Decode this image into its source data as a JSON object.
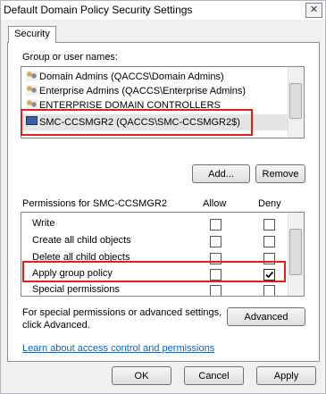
{
  "window": {
    "title": "Default Domain Policy Security Settings",
    "close_glyph": "✕"
  },
  "tabs": [
    {
      "label": "Security"
    }
  ],
  "groups": {
    "heading": "Group or user names:",
    "items": [
      {
        "label": "Domain Admins (QACCS\\Domain Admins)",
        "icon": "group-icon"
      },
      {
        "label": "Enterprise Admins (QACCS\\Enterprise Admins)",
        "icon": "group-icon"
      },
      {
        "label": "ENTERPRISE DOMAIN CONTROLLERS",
        "icon": "group-icon"
      },
      {
        "label": "SMC-CCSMGR2 (QACCS\\SMC-CCSMGR2$)",
        "icon": "computer-icon",
        "selected": true
      }
    ],
    "add_label": "Add...",
    "remove_label": "Remove"
  },
  "permissions": {
    "heading": "Permissions for SMC-CCSMGR2",
    "allow_header": "Allow",
    "deny_header": "Deny",
    "rows": [
      {
        "label": "Write",
        "allow": false,
        "deny": false
      },
      {
        "label": "Create all child objects",
        "allow": false,
        "deny": false
      },
      {
        "label": "Delete all child objects",
        "allow": false,
        "deny": false
      },
      {
        "label": "Apply group policy",
        "allow": false,
        "deny": true
      },
      {
        "label": "Special permissions",
        "allow": false,
        "deny": false
      }
    ]
  },
  "advanced": {
    "text_line1": "For special permissions or advanced settings,",
    "text_line2": "click Advanced.",
    "button_label": "Advanced"
  },
  "learn_link": "Learn about access control and permissions",
  "footer": {
    "ok_label": "OK",
    "cancel_label": "Cancel",
    "apply_label": "Apply"
  },
  "colors": {
    "highlight_box": "#e1201d",
    "link": "#0066cc"
  }
}
